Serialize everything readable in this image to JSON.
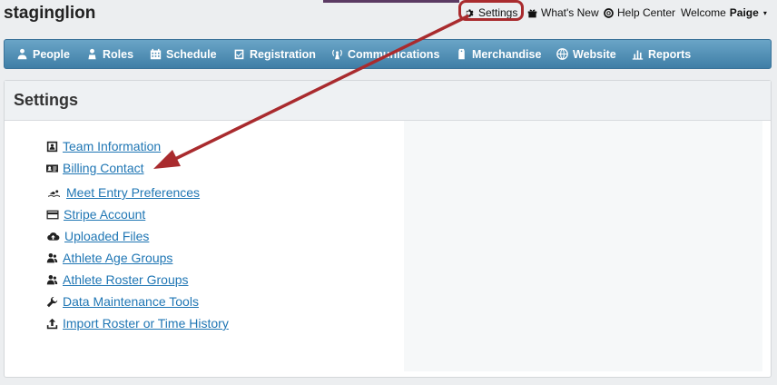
{
  "app": {
    "title": "staginglion"
  },
  "toplinks": {
    "settings": "Settings",
    "whats_new": "What's New",
    "help_center": "Help Center",
    "welcome": "Welcome",
    "user_name": "Paige"
  },
  "nav": {
    "items": [
      {
        "label": "People",
        "icon": "people-icon"
      },
      {
        "label": "Roles",
        "icon": "roles-icon"
      },
      {
        "label": "Schedule",
        "icon": "calendar-icon"
      },
      {
        "label": "Registration",
        "icon": "clipboard-check-icon"
      },
      {
        "label": "Communications",
        "icon": "antenna-icon"
      },
      {
        "label": "Merchandise",
        "icon": "tag-icon"
      },
      {
        "label": "Website",
        "icon": "globe-icon"
      },
      {
        "label": "Reports",
        "icon": "bar-chart-icon"
      }
    ]
  },
  "panel": {
    "title": "Settings"
  },
  "settings_links": [
    {
      "label": "Team Information",
      "icon": "id-badge-icon"
    },
    {
      "label": "Billing Contact",
      "icon": "contact-card-icon"
    },
    {
      "label": "Meet Entry Preferences",
      "icon": "swimmer-icon"
    },
    {
      "label": "Stripe Account",
      "icon": "credit-card-icon"
    },
    {
      "label": "Uploaded Files",
      "icon": "cloud-upload-icon"
    },
    {
      "label": "Athlete Age Groups",
      "icon": "athlete-group-icon"
    },
    {
      "label": "Athlete Roster Groups",
      "icon": "athlete-roster-icon"
    },
    {
      "label": "Data Maintenance Tools",
      "icon": "wrench-icon"
    },
    {
      "label": "Import Roster or Time History",
      "icon": "upload-icon"
    }
  ],
  "colors": {
    "nav_bg": "#4d8cb4",
    "link": "#1f76b4",
    "annotation": "#a92b2e"
  }
}
